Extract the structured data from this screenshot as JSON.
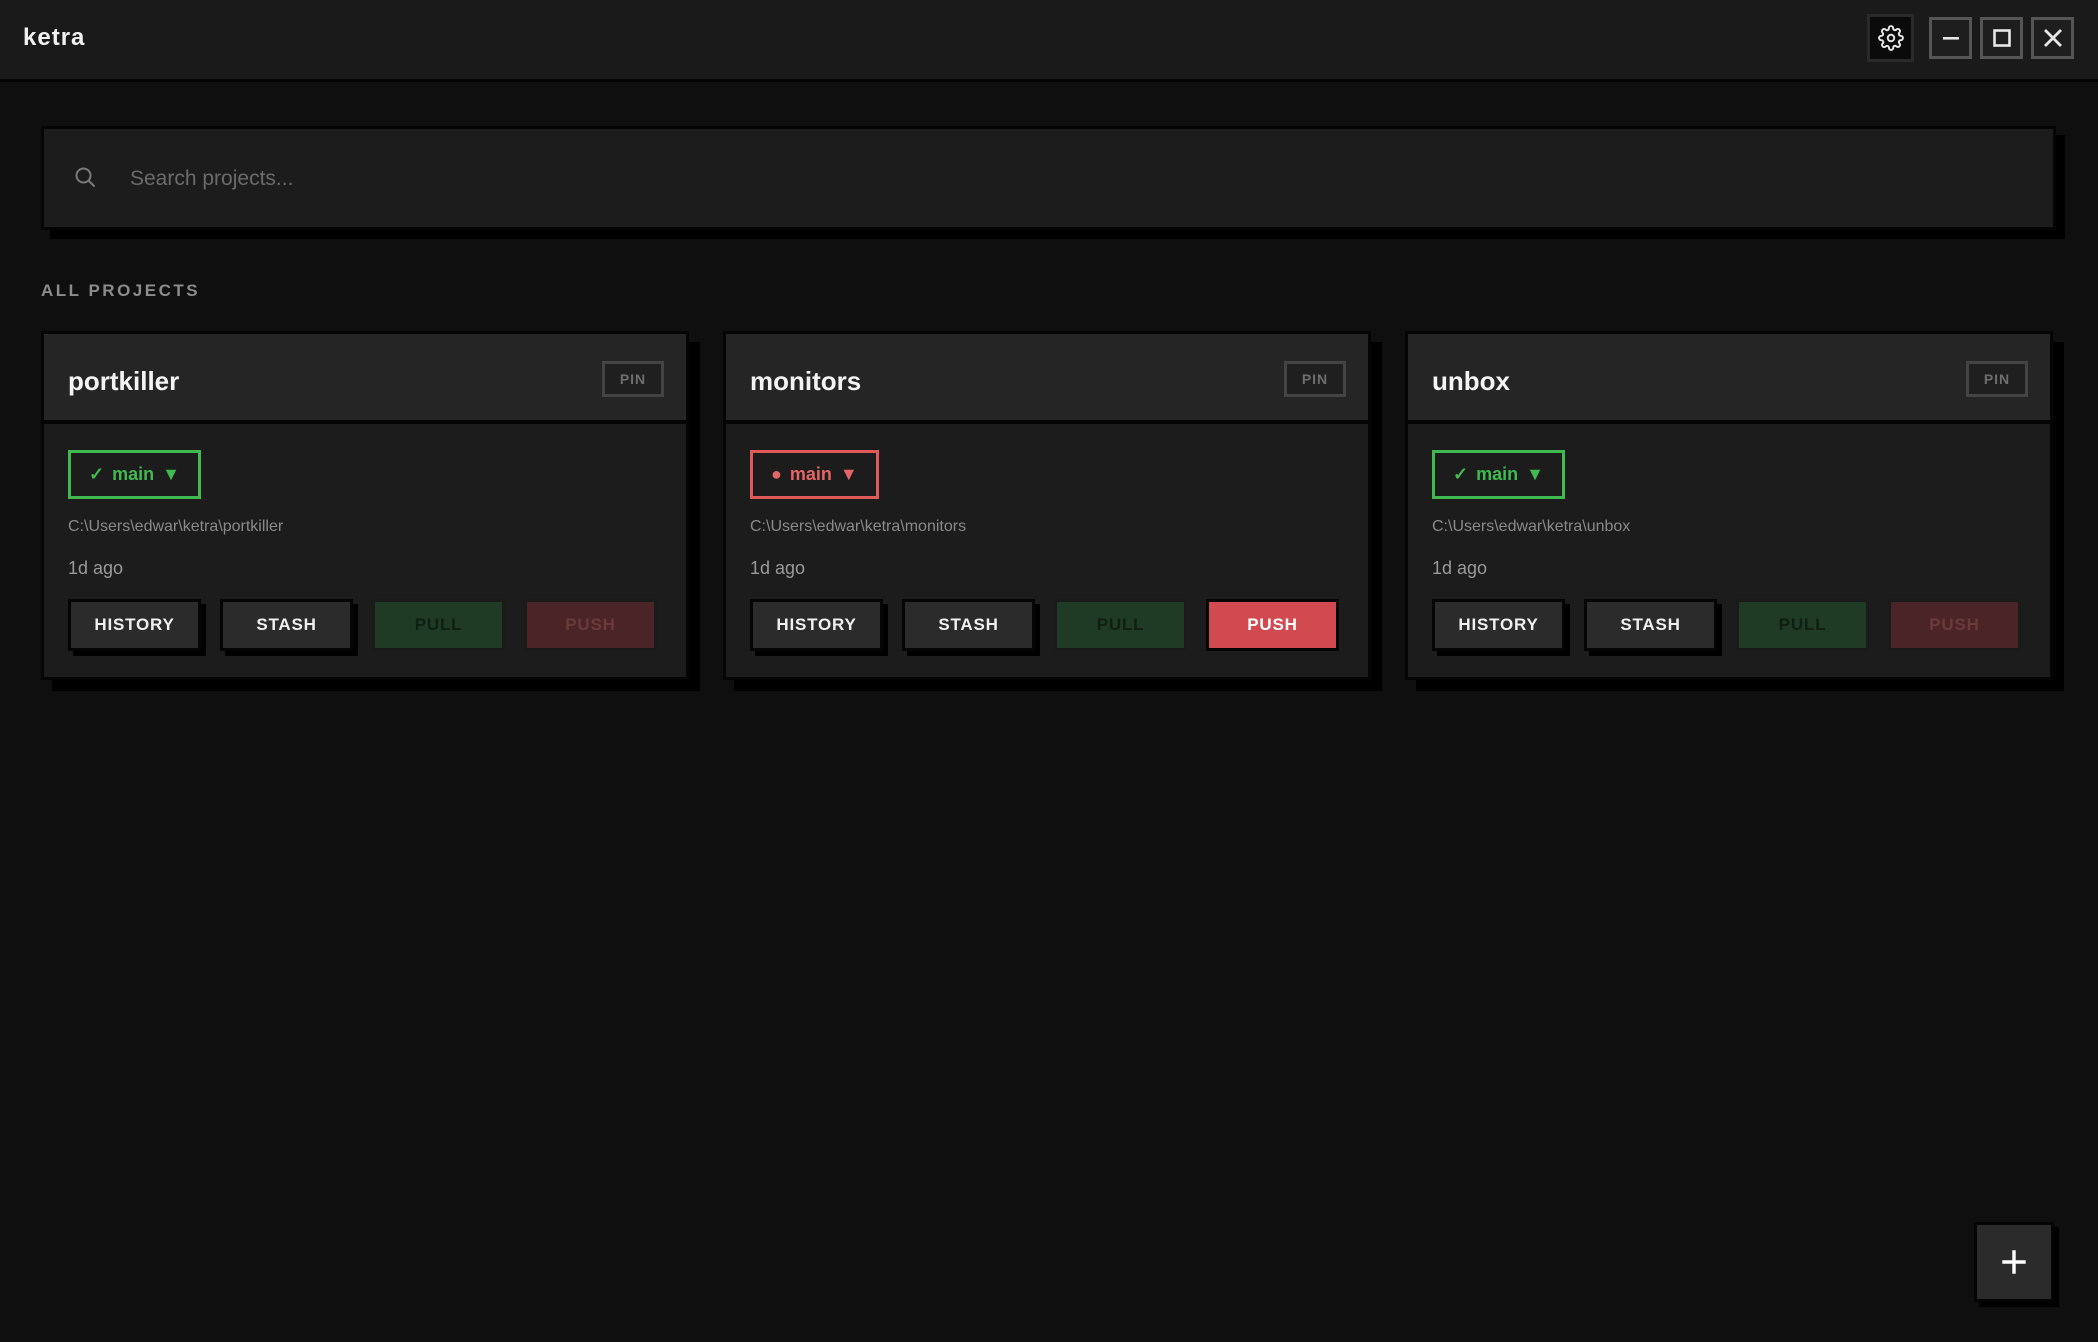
{
  "app": {
    "title": "ketra"
  },
  "window_controls": {
    "settings_icon": "gear-icon",
    "minimize_icon": "minimize-icon",
    "maximize_icon": "maximize-icon",
    "close_icon": "close-icon"
  },
  "search": {
    "placeholder": "Search projects...",
    "value": "",
    "icon": "search-icon"
  },
  "section": {
    "label": "ALL PROJECTS"
  },
  "colors": {
    "accent_green": "#3fb950",
    "accent_red": "#e05a5a",
    "push_active": "#d04a4f",
    "pull_bg": "#1f3a25"
  },
  "projects": [
    {
      "name": "portkiller",
      "pin_label": "PIN",
      "branch_status": "✓",
      "branch_name": "main",
      "branch_caret": "▼",
      "path": "C:\\Users\\edwar\\ketra\\portkiller",
      "updated": "1d ago",
      "actions": {
        "history": "HISTORY",
        "stash": "STASH",
        "pull": "PULL",
        "push": "PUSH"
      }
    },
    {
      "name": "monitors",
      "pin_label": "PIN",
      "branch_status": "●",
      "branch_name": "main",
      "branch_caret": "▼",
      "path": "C:\\Users\\edwar\\ketra\\monitors",
      "updated": "1d ago",
      "actions": {
        "history": "HISTORY",
        "stash": "STASH",
        "pull": "PULL",
        "push": "PUSH"
      }
    },
    {
      "name": "unbox",
      "pin_label": "PIN",
      "branch_status": "✓",
      "branch_name": "main",
      "branch_caret": "▼",
      "path": "C:\\Users\\edwar\\ketra\\unbox",
      "updated": "1d ago",
      "actions": {
        "history": "HISTORY",
        "stash": "STASH",
        "pull": "PULL",
        "push": "PUSH"
      }
    }
  ],
  "fab": {
    "label": "+",
    "icon": "plus-icon"
  }
}
